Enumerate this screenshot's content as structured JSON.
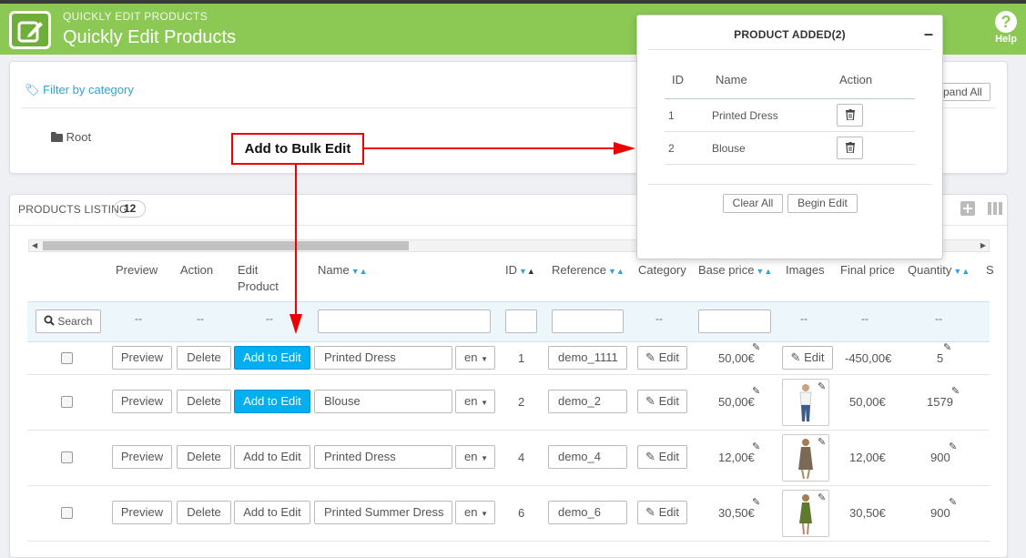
{
  "header": {
    "subtitle": "QUICKLY EDIT PRODUCTS",
    "title": "Quickly Edit Products",
    "help_label": "Help",
    "help_icon": "question-icon"
  },
  "filter": {
    "link_label": "Filter by category",
    "expand_label": "pand All",
    "root_label": "Root"
  },
  "listing": {
    "title": "PRODUCTS LISTING",
    "count": "12"
  },
  "columns": {
    "preview": "Preview",
    "action": "Action",
    "edit_product_1": "Edit",
    "edit_product_2": "Product",
    "name": "Name",
    "id": "ID",
    "reference": "Reference",
    "category": "Category",
    "base_price": "Base price",
    "images": "Images",
    "final_price": "Final price",
    "quantity": "Quantity",
    "status_cut": "S"
  },
  "filters": {
    "search_label": "Search",
    "dash": "--"
  },
  "row_buttons": {
    "preview": "Preview",
    "delete": "Delete",
    "add_to_edit": "Add to Edit",
    "edit": "Edit",
    "lang": "en"
  },
  "rows": [
    {
      "name": "Printed Dress",
      "id": "1",
      "reference": "demo_1111",
      "base_price": "50,00€",
      "final_price": "-450,00€",
      "quantity": "5",
      "added": true
    },
    {
      "name": "Blouse",
      "id": "2",
      "reference": "demo_2",
      "base_price": "50,00€",
      "final_price": "50,00€",
      "quantity": "1579",
      "added": true
    },
    {
      "name": "Printed Dress",
      "id": "4",
      "reference": "demo_4",
      "base_price": "12,00€",
      "final_price": "12,00€",
      "quantity": "900",
      "added": false
    },
    {
      "name": "Printed Summer Dress",
      "id": "6",
      "reference": "demo_6",
      "base_price": "30,50€",
      "final_price": "30,50€",
      "quantity": "900",
      "added": false
    }
  ],
  "popup": {
    "title": "PRODUCT ADDED(2)",
    "col_id": "ID",
    "col_name": "Name",
    "col_action": "Action",
    "items": [
      {
        "id": "1",
        "name": "Printed Dress"
      },
      {
        "id": "2",
        "name": "Blouse"
      }
    ],
    "clear_all": "Clear All",
    "begin_edit": "Begin Edit"
  },
  "annotation": {
    "label": "Add to Bulk Edit",
    "color": "#ee0000"
  },
  "colors": {
    "header_green": "#8bc954",
    "accent_blue": "#00aff0",
    "link_blue": "#2fa4d8"
  }
}
